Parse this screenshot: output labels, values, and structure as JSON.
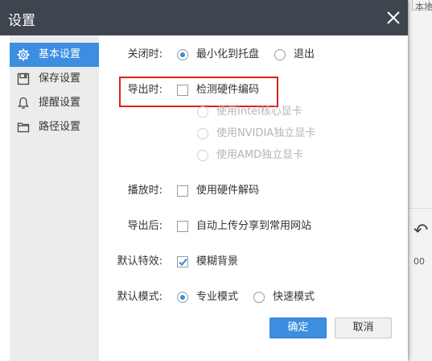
{
  "dialog": {
    "title": "设置",
    "close_icon": "close-icon"
  },
  "sidebar": {
    "items": [
      {
        "label": "基本设置",
        "icon": "gear-icon",
        "active": true
      },
      {
        "label": "保存设置",
        "icon": "save-icon",
        "active": false
      },
      {
        "label": "提醒设置",
        "icon": "bell-icon",
        "active": false
      },
      {
        "label": "路径设置",
        "icon": "folder-icon",
        "active": false
      }
    ]
  },
  "settings": {
    "on_close": {
      "label": "关闭时:",
      "options": [
        {
          "label": "最小化到托盘",
          "checked": true
        },
        {
          "label": "退出",
          "checked": false
        }
      ]
    },
    "on_export": {
      "label": "导出时:",
      "hw_encode": {
        "label": "检测硬件编码",
        "checked": false
      },
      "gpu_options": [
        {
          "label": "使用Intel核心显卡",
          "disabled": true
        },
        {
          "label": "使用NVIDIA独立显卡",
          "disabled": true
        },
        {
          "label": "使用AMD独立显卡",
          "disabled": true
        }
      ]
    },
    "on_play": {
      "label": "播放时:",
      "hw_decode": {
        "label": "使用硬件解码",
        "checked": false
      }
    },
    "after_export": {
      "label": "导出后:",
      "auto_upload": {
        "label": "自动上传分享到常用网站",
        "checked": false
      }
    },
    "default_effect": {
      "label": "默认特效:",
      "blur_bg": {
        "label": "模糊背景",
        "checked": true
      }
    },
    "default_mode": {
      "label": "默认模式:",
      "options": [
        {
          "label": "专业模式",
          "checked": true
        },
        {
          "label": "快速模式",
          "checked": false
        }
      ]
    }
  },
  "buttons": {
    "ok": "确定",
    "cancel": "取消"
  },
  "background": {
    "peek_text": "本地",
    "peek_number": "00"
  },
  "colors": {
    "titlebar": "#3f454f",
    "accent": "#3b8ee0",
    "highlight": "#e02020",
    "disabled_text": "#b5b5b5"
  }
}
